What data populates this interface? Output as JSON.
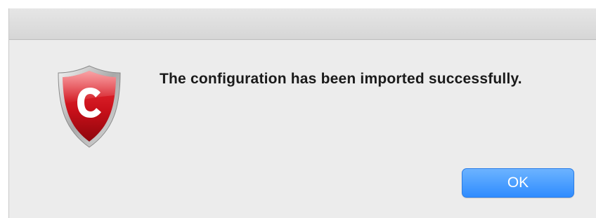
{
  "dialog": {
    "message": "The configuration has been imported successfully.",
    "ok_label": "OK",
    "icon": "comodo-shield-icon"
  },
  "colors": {
    "accent_button": "#2f8cff",
    "shield_red": "#d4141c"
  }
}
